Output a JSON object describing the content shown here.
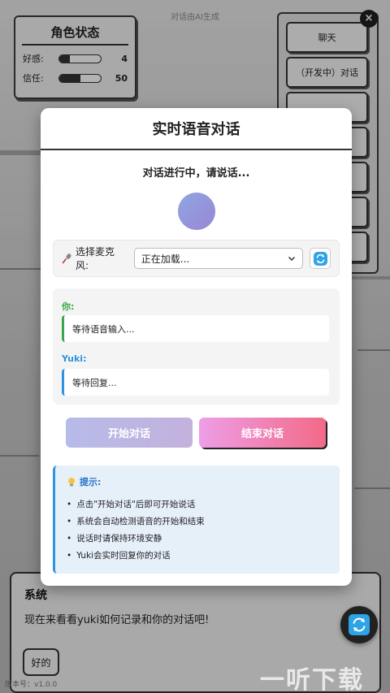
{
  "scene": {
    "ai_note": "对话由AI生成"
  },
  "stats": {
    "title": "角色状态",
    "rows": [
      {
        "label": "好感:",
        "value": "4",
        "level_percent": 25
      },
      {
        "label": "信任:",
        "value": "50",
        "level_percent": 50
      }
    ]
  },
  "side_menu": [
    "聊天",
    "（开发中）对话",
    "",
    "",
    "",
    "",
    ""
  ],
  "close_label": "×",
  "dialog": {
    "speaker": "系统",
    "text": "现在来看看yuki如何记录和你的对话吧!",
    "choice": "好的"
  },
  "version": "版本号：v1.0.0",
  "watermark": "一听下载",
  "modal": {
    "title": "实时语音对话",
    "status": "对话进行中，请说话...",
    "mic": {
      "label": "选择麦克风:",
      "icon": "microphone-icon",
      "selected": "正在加载..."
    },
    "conversation": {
      "user_label": "你:",
      "user_text": "等待语音输入...",
      "ai_label": "Yuki:",
      "ai_text": "等待回复..."
    },
    "buttons": {
      "start": "开始对话",
      "end": "结束对话"
    },
    "tips": {
      "title": "提示:",
      "items": [
        "点击\"开始对话\"后即可开始说话",
        "系统会自动检测语音的开始和结束",
        "说话时请保持环境安静",
        "Yuki会实时回复你的对话"
      ]
    }
  },
  "colors": {
    "user_accent": "#3aa84a",
    "ai_accent": "#2e93e0",
    "start_gradient": [
      "#b6bbe9",
      "#c4b1dc"
    ],
    "end_gradient": [
      "#ee9ee7",
      "#f26a87"
    ],
    "orb_gradient": [
      "#8ea6e4",
      "#9a86d4"
    ]
  }
}
